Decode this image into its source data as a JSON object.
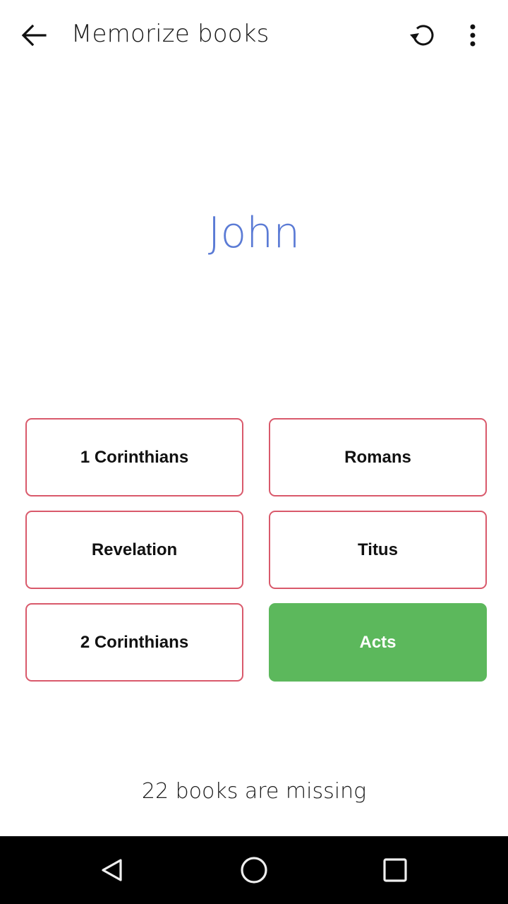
{
  "appbar": {
    "title": "Memorize books",
    "icons": {
      "back": "arrow-left-icon",
      "reset": "restart-icon",
      "more": "more-vertical-icon"
    }
  },
  "quiz": {
    "question": "John",
    "question_color": "#5b7bd5",
    "answers": [
      {
        "label": "1 Corinthians",
        "state": "wrong"
      },
      {
        "label": "Romans",
        "state": "wrong"
      },
      {
        "label": "Revelation",
        "state": "wrong"
      },
      {
        "label": "Titus",
        "state": "wrong"
      },
      {
        "label": "2 Corinthians",
        "state": "wrong"
      },
      {
        "label": "Acts",
        "state": "correct"
      }
    ],
    "colors": {
      "wrong_border": "#d9596b",
      "correct_fill": "#5cb85c"
    }
  },
  "status": {
    "text": "22 books are missing"
  },
  "navbar": {
    "icons": {
      "back": "nav-back-triangle-icon",
      "home": "nav-home-circle-icon",
      "recents": "nav-recents-square-icon"
    }
  }
}
